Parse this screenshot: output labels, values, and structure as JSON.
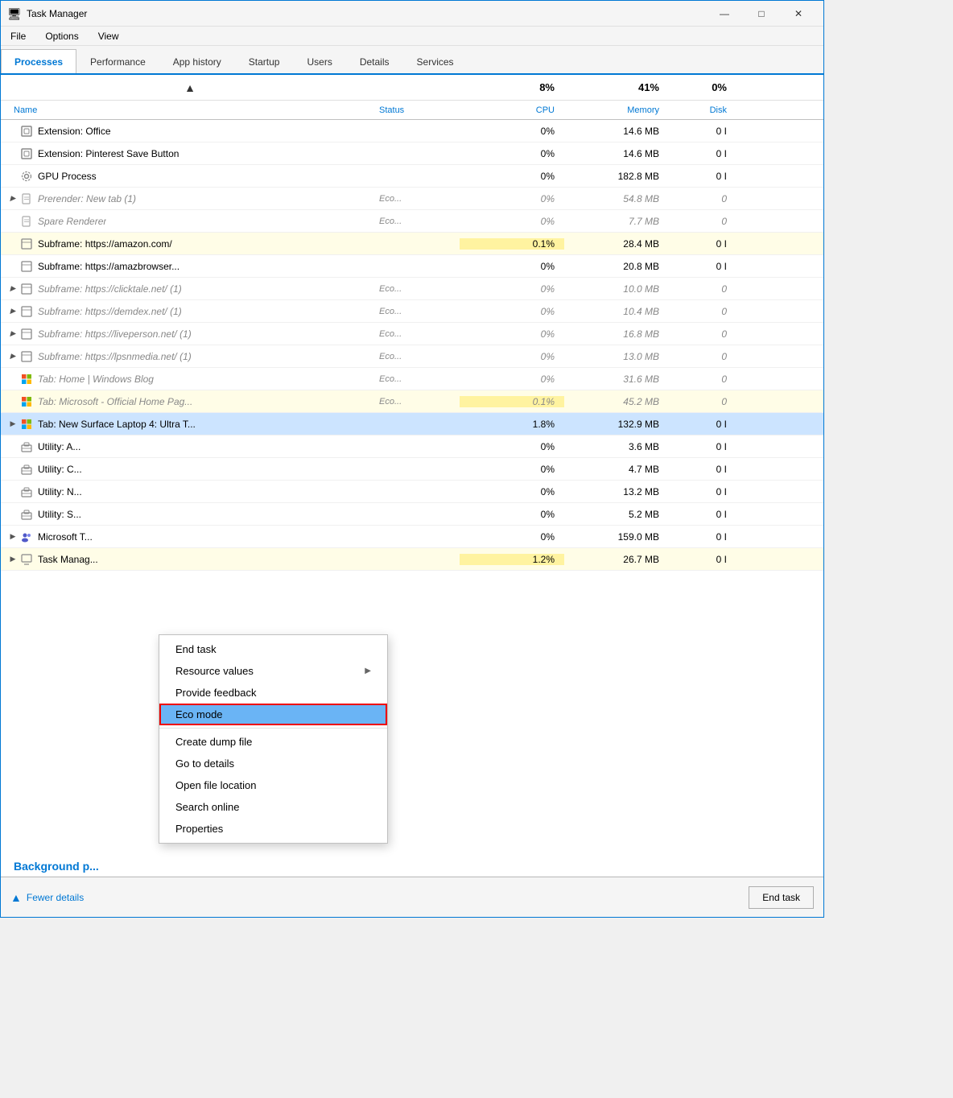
{
  "window": {
    "title": "Task Manager",
    "icon": "⊞"
  },
  "title_bar": {
    "title": "Task Manager",
    "minimize": "—",
    "maximize": "□",
    "close": "✕"
  },
  "menu": {
    "items": [
      "File",
      "Options",
      "View"
    ]
  },
  "tabs": [
    {
      "label": "Processes",
      "active": true
    },
    {
      "label": "Performance",
      "active": false
    },
    {
      "label": "App history",
      "active": false
    },
    {
      "label": "Startup",
      "active": false
    },
    {
      "label": "Users",
      "active": false
    },
    {
      "label": "Details",
      "active": false
    },
    {
      "label": "Services",
      "active": false
    }
  ],
  "sort_row": {
    "cpu_pct": "8%",
    "mem_pct": "41%",
    "disk_pct": "0%"
  },
  "headers": {
    "name": "Name",
    "status": "Status",
    "cpu": "CPU",
    "memory": "Memory",
    "disk": "Disk"
  },
  "processes": [
    {
      "name": "Extension: Office",
      "icon": "◫",
      "icon_color": "#888",
      "status": "",
      "cpu": "0%",
      "memory": "14.6 MB",
      "disk": "0 I",
      "eco": false,
      "expandable": false,
      "selected": false
    },
    {
      "name": "Extension: Pinterest Save Button",
      "icon": "◫",
      "icon_color": "#888",
      "status": "",
      "cpu": "0%",
      "memory": "14.6 MB",
      "disk": "0 I",
      "eco": false,
      "expandable": false,
      "selected": false
    },
    {
      "name": "GPU Process",
      "icon": "⚙",
      "icon_color": "#888",
      "status": "",
      "cpu": "0%",
      "memory": "182.8 MB",
      "disk": "0 I",
      "eco": false,
      "expandable": false,
      "selected": false
    },
    {
      "name": "Prerender: New tab (1)",
      "icon": "📄",
      "icon_color": "#aaa",
      "status": "Eco...",
      "cpu": "0%",
      "memory": "54.8 MB",
      "disk": "0",
      "eco": true,
      "expandable": true,
      "selected": false
    },
    {
      "name": "Spare Renderer",
      "icon": "📄",
      "icon_color": "#aaa",
      "status": "Eco...",
      "cpu": "0%",
      "memory": "7.7 MB",
      "disk": "0",
      "eco": true,
      "expandable": false,
      "selected": false
    },
    {
      "name": "Subframe: https://amazon.com/",
      "icon": "▣",
      "icon_color": "#888",
      "status": "",
      "cpu": "0.1%",
      "memory": "28.4 MB",
      "disk": "0 I",
      "eco": false,
      "expandable": false,
      "selected": false,
      "cpu_hi": true
    },
    {
      "name": "Subframe: https://amazbrowser...",
      "icon": "▣",
      "icon_color": "#888",
      "status": "",
      "cpu": "0%",
      "memory": "20.8 MB",
      "disk": "0 I",
      "eco": false,
      "expandable": false,
      "selected": false
    },
    {
      "name": "Subframe: https://clicktale.net/ (1)",
      "icon": "▣",
      "icon_color": "#888",
      "status": "Eco...",
      "cpu": "0%",
      "memory": "10.0 MB",
      "disk": "0",
      "eco": true,
      "expandable": true,
      "selected": false
    },
    {
      "name": "Subframe: https://demdex.net/ (1)",
      "icon": "▣",
      "icon_color": "#888",
      "status": "Eco...",
      "cpu": "0%",
      "memory": "10.4 MB",
      "disk": "0",
      "eco": true,
      "expandable": true,
      "selected": false
    },
    {
      "name": "Subframe: https://liveperson.net/ (1)",
      "icon": "▣",
      "icon_color": "#888",
      "status": "Eco...",
      "cpu": "0%",
      "memory": "16.8 MB",
      "disk": "0",
      "eco": true,
      "expandable": true,
      "selected": false
    },
    {
      "name": "Subframe: https://lpsnmedia.net/ (1)",
      "icon": "▣",
      "icon_color": "#888",
      "status": "Eco...",
      "cpu": "0%",
      "memory": "13.0 MB",
      "disk": "0",
      "eco": true,
      "expandable": true,
      "selected": false
    },
    {
      "name": "Tab: Home | Windows Blog",
      "icon": "⊞",
      "icon_color": "#0078d4",
      "status": "Eco...",
      "cpu": "0%",
      "memory": "31.6 MB",
      "disk": "0",
      "eco": true,
      "expandable": false,
      "selected": false
    },
    {
      "name": "Tab: Microsoft - Official Home Pag...",
      "icon": "⊞",
      "icon_color": "#f25022",
      "status": "Eco...",
      "cpu": "0.1%",
      "memory": "45.2 MB",
      "disk": "0",
      "eco": true,
      "expandable": false,
      "selected": false,
      "cpu_hi": true
    },
    {
      "name": "Tab: New Surface Laptop 4: Ultra T...",
      "icon": "⊞",
      "icon_color": "#f25022",
      "status": "",
      "cpu": "1.8%",
      "memory": "132.9 MB",
      "disk": "0 I",
      "eco": false,
      "expandable": true,
      "selected": true
    },
    {
      "name": "Utility: A...",
      "icon": "🧰",
      "icon_color": "#888",
      "status": "",
      "cpu": "0%",
      "memory": "3.6 MB",
      "disk": "0 I",
      "eco": false,
      "expandable": false,
      "selected": false
    },
    {
      "name": "Utility: C...",
      "icon": "🧰",
      "icon_color": "#888",
      "status": "",
      "cpu": "0%",
      "memory": "4.7 MB",
      "disk": "0 I",
      "eco": false,
      "expandable": false,
      "selected": false
    },
    {
      "name": "Utility: N...",
      "icon": "🧰",
      "icon_color": "#888",
      "status": "",
      "cpu": "0%",
      "memory": "13.2 MB",
      "disk": "0 I",
      "eco": false,
      "expandable": false,
      "selected": false
    },
    {
      "name": "Utility: S...",
      "icon": "🧰",
      "icon_color": "#888",
      "status": "",
      "cpu": "0%",
      "memory": "5.2 MB",
      "disk": "0 I",
      "eco": false,
      "expandable": false,
      "selected": false
    },
    {
      "name": "Microsoft T...",
      "icon": "👥",
      "icon_color": "#5059c9",
      "status": "",
      "cpu": "0%",
      "memory": "159.0 MB",
      "disk": "0 I",
      "eco": false,
      "expandable": true,
      "selected": false
    },
    {
      "name": "Task Manag...",
      "icon": "🖥",
      "icon_color": "#888",
      "status": "",
      "cpu": "1.2%",
      "memory": "26.7 MB",
      "disk": "0 I",
      "eco": false,
      "expandable": true,
      "selected": false,
      "cpu_hi": true
    }
  ],
  "background_label": "Background p...",
  "context_menu": {
    "items": [
      {
        "label": "End task",
        "type": "item"
      },
      {
        "label": "Resource values",
        "type": "item",
        "arrow": true
      },
      {
        "label": "Provide feedback",
        "type": "item"
      },
      {
        "label": "Eco mode",
        "type": "item",
        "highlighted": true
      },
      {
        "label": "Create dump file",
        "type": "item"
      },
      {
        "label": "Go to details",
        "type": "item"
      },
      {
        "label": "Open file location",
        "type": "item"
      },
      {
        "label": "Search online",
        "type": "item"
      },
      {
        "label": "Properties",
        "type": "item"
      }
    ]
  },
  "footer": {
    "fewer_details": "Fewer details",
    "end_task": "End task"
  }
}
